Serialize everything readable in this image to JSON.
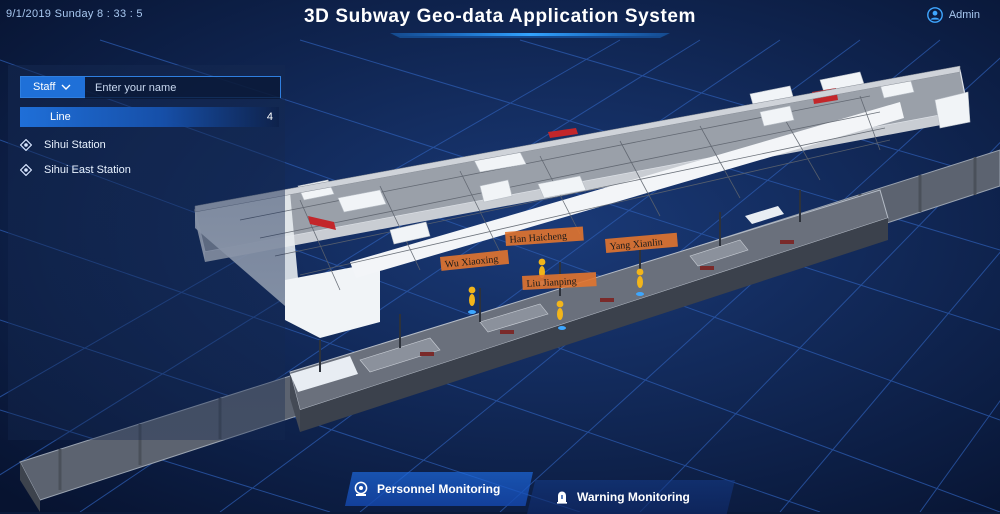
{
  "header": {
    "datetime": "9/1/2019 Sunday  8 : 33 : 5",
    "title": "3D Subway Geo-data Application System",
    "user_label": "Admin",
    "user_icon": "user-circle-icon"
  },
  "panel": {
    "staff_select": {
      "label": "Staff",
      "icon": "chevron-down-icon"
    },
    "name_input": {
      "placeholder": "Enter your name",
      "value": ""
    },
    "line": {
      "label": "Line",
      "count": "4"
    },
    "stations": [
      {
        "label": "Sihui Station",
        "icon": "diamond-target-icon"
      },
      {
        "label": "Sihui East Station",
        "icon": "diamond-target-icon"
      }
    ]
  },
  "personnel": [
    {
      "name": "Wu Xiaoxing"
    },
    {
      "name": "Han Haicheng"
    },
    {
      "name": "Liu Jianping"
    },
    {
      "name": "Yang Xianlin"
    }
  ],
  "tabs": {
    "personnel": {
      "label": "Personnel Monitoring",
      "icon": "camera-icon",
      "active": true
    },
    "warning": {
      "label": "Warning Monitoring",
      "icon": "alarm-icon",
      "active": false
    }
  },
  "colors": {
    "accent": "#1f70d8",
    "background": "#0a1a3a",
    "grid": "#2a56a8",
    "tag_orange": "#e2742e"
  }
}
